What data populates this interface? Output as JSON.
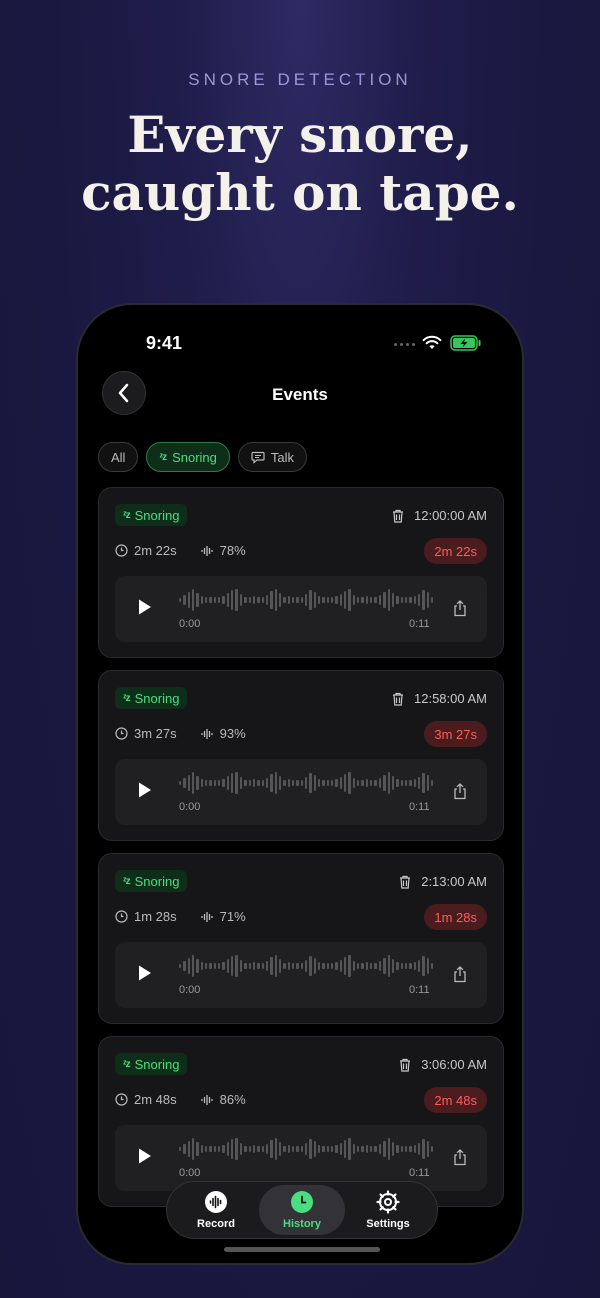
{
  "promo": {
    "eyebrow": "SNORE DETECTION",
    "headline_line1": "Every snore,",
    "headline_line2": "caught on tape."
  },
  "status_bar": {
    "time": "9:41"
  },
  "nav": {
    "title": "Events"
  },
  "filters": [
    {
      "label": "All",
      "active": false
    },
    {
      "label": "Snoring",
      "active": true
    },
    {
      "label": "Talk",
      "active": false
    }
  ],
  "events": [
    {
      "tag": "Snoring",
      "time": "12:00:00 AM",
      "duration": "2m 22s",
      "confidence": "78%",
      "badge": "2m 22s",
      "start": "0:00",
      "end": "0:11"
    },
    {
      "tag": "Snoring",
      "time": "12:58:00 AM",
      "duration": "3m 27s",
      "confidence": "93%",
      "badge": "3m 27s",
      "start": "0:00",
      "end": "0:11"
    },
    {
      "tag": "Snoring",
      "time": "2:13:00 AM",
      "duration": "1m 28s",
      "confidence": "71%",
      "badge": "1m 28s",
      "start": "0:00",
      "end": "0:11"
    },
    {
      "tag": "Snoring",
      "time": "3:06:00 AM",
      "duration": "2m 48s",
      "confidence": "86%",
      "badge": "2m 48s",
      "start": "0:00",
      "end": "0:11"
    }
  ],
  "tabbar": {
    "record": "Record",
    "history": "History",
    "settings": "Settings"
  },
  "colors": {
    "accent_green": "#4ade80",
    "alert_red": "#ff5d5d",
    "background": "#1f1c4a"
  }
}
